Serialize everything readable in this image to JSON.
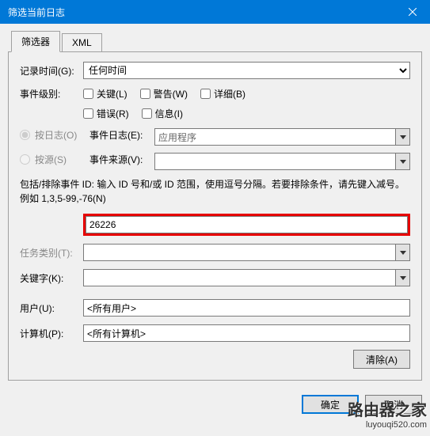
{
  "title": "筛选当前日志",
  "tabs": {
    "filter": "筛选器",
    "xml": "XML"
  },
  "labels": {
    "logged": "记录时间(G):",
    "level": "事件级别:",
    "byLog": "按日志(O)",
    "bySource": "按源(S)",
    "eventLogs": "事件日志(E):",
    "eventSources": "事件来源(V):",
    "taskCategory": "任务类别(T):",
    "keywords": "关键字(K):",
    "user": "用户(U):",
    "computer": "计算机(P):"
  },
  "values": {
    "logged": "任何时间",
    "eventLogs": "应用程序",
    "eventId": "26226",
    "user": "<所有用户>",
    "computer": "<所有计算机>"
  },
  "checkboxes": {
    "critical": "关键(L)",
    "warning": "警告(W)",
    "verbose": "详细(B)",
    "error": "错误(R)",
    "information": "信息(I)"
  },
  "hint": "包括/排除事件 ID: 输入 ID 号和/或 ID 范围，使用逗号分隔。若要排除条件，请先键入减号。例如 1,3,5-99,-76(N)",
  "buttons": {
    "clear": "清除(A)",
    "ok": "确定",
    "cancel": "取消"
  },
  "watermark": {
    "line1": "路由器之家",
    "line2": "luyouqi520.com"
  }
}
